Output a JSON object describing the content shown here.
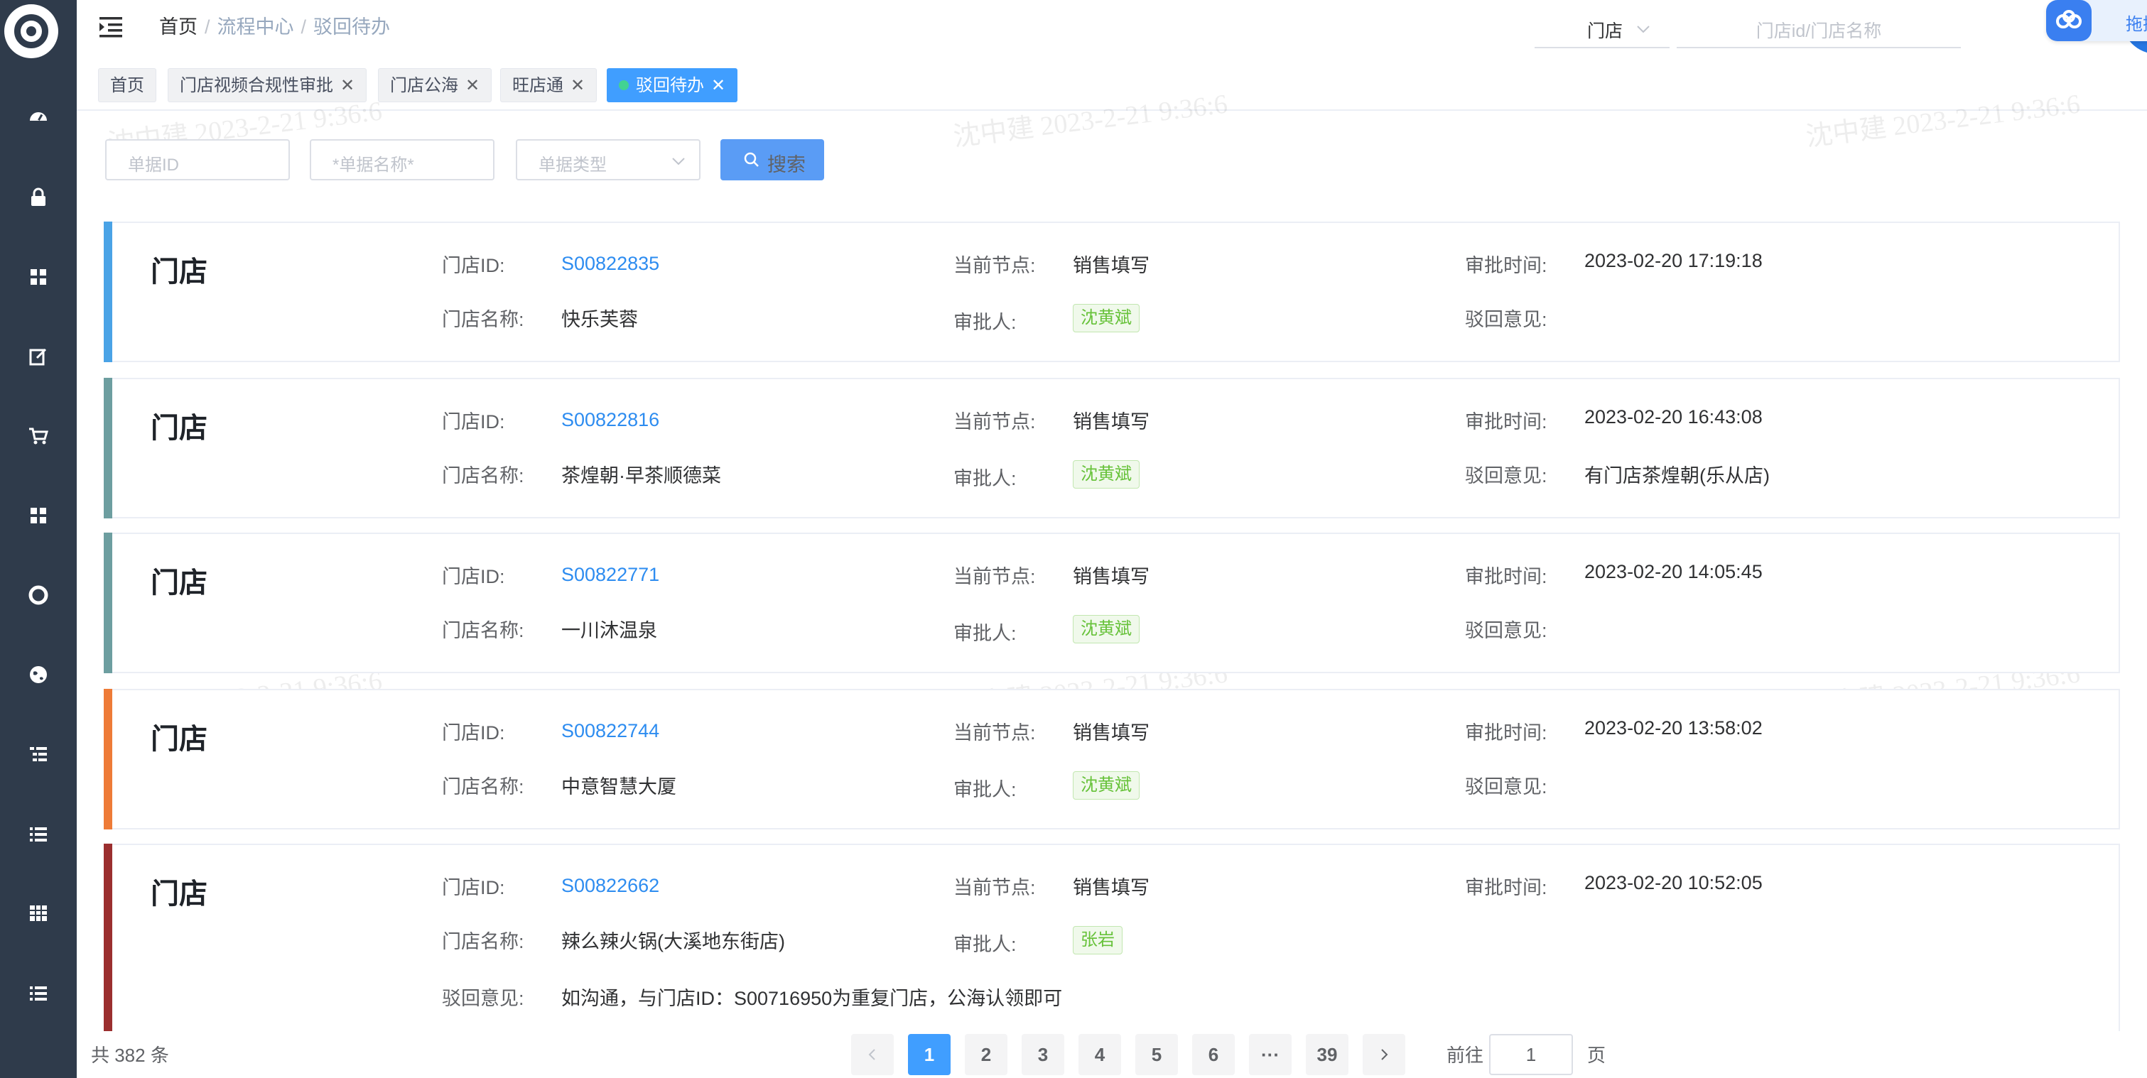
{
  "header": {
    "breadcrumb": [
      "首页",
      "流程中心",
      "驳回待办"
    ],
    "store_select": "门店",
    "store_input_placeholder": "门店id/门店名称",
    "upload_label": "拖拽上传"
  },
  "tags": [
    {
      "label": "首页",
      "closable": false,
      "active": false
    },
    {
      "label": "门店视频合规性审批",
      "closable": true,
      "active": false
    },
    {
      "label": "门店公海",
      "closable": true,
      "active": false
    },
    {
      "label": "旺店通",
      "closable": true,
      "active": false
    },
    {
      "label": "驳回待办",
      "closable": true,
      "active": true
    }
  ],
  "filters": {
    "doc_id_placeholder": "单据ID",
    "doc_name_placeholder": "*单据名称*",
    "doc_type_placeholder": "单据类型",
    "search_label": "搜索"
  },
  "labels": {
    "store_id": "门店ID:",
    "store_name": "门店名称:",
    "current_node": "当前节点:",
    "approver": "审批人:",
    "approve_time": "审批时间:",
    "reject_opinion": "驳回意见:"
  },
  "records": [
    {
      "title": "门店",
      "store_id": "S00822835",
      "store_name": "快乐芙蓉",
      "node": "销售填写",
      "approver": "沈黄斌",
      "time": "2023-02-20 17:19:18",
      "opinion": "",
      "bar_color": "#4aa3e6"
    },
    {
      "title": "门店",
      "store_id": "S00822816",
      "store_name": "茶煌朝·早茶顺德菜",
      "node": "销售填写",
      "approver": "沈黄斌",
      "time": "2023-02-20 16:43:08",
      "opinion": "有门店茶煌朝(乐从店)",
      "bar_color": "#6d9ea0"
    },
    {
      "title": "门店",
      "store_id": "S00822771",
      "store_name": "一川沐温泉",
      "node": "销售填写",
      "approver": "沈黄斌",
      "time": "2023-02-20 14:05:45",
      "opinion": "",
      "bar_color": "#6d9ea0"
    },
    {
      "title": "门店",
      "store_id": "S00822744",
      "store_name": "中意智慧大厦",
      "node": "销售填写",
      "approver": "沈黄斌",
      "time": "2023-02-20 13:58:02",
      "opinion": "",
      "bar_color": "#ee7b37"
    },
    {
      "title": "门店",
      "store_id": "S00822662",
      "store_name": "辣么辣火锅(大溪地东街店)",
      "node": "销售填写",
      "approver": "张岩",
      "time": "2023-02-20 10:52:05",
      "opinion": "如沟通，与门店ID：S00716950为重复门店，公海认领即可",
      "bar_color": "#9b2f2f"
    }
  ],
  "watermark": "沈中建 2023-2-21 9:36:6",
  "pagination": {
    "total": "共 382 条",
    "pages": [
      "1",
      "2",
      "3",
      "4",
      "5",
      "6",
      "···",
      "39"
    ],
    "current": "1",
    "goto_prefix": "前往",
    "goto_value": "1",
    "goto_suffix": "页"
  }
}
